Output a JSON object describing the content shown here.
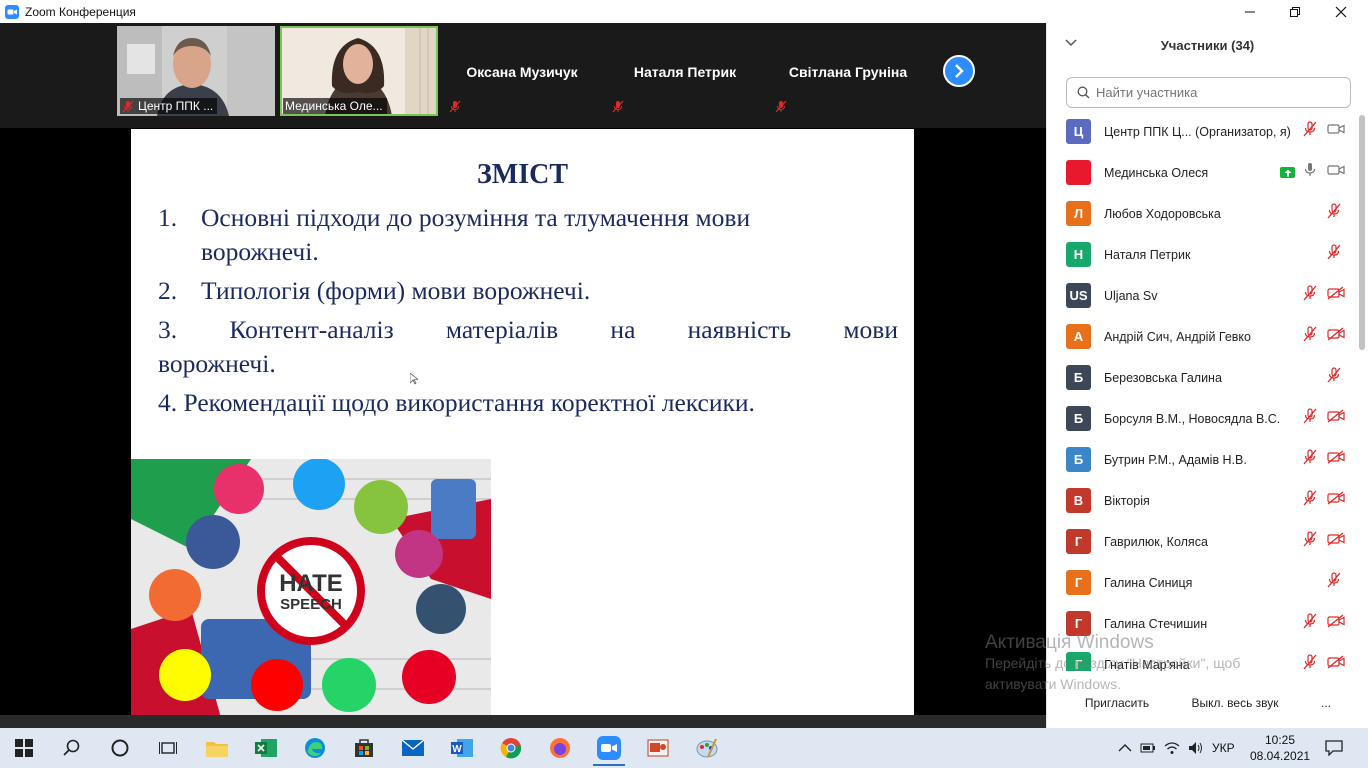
{
  "window": {
    "title": "Zoom Конференция"
  },
  "gallery": {
    "tiles": [
      {
        "name": "Центр ППК ...",
        "type": "video"
      },
      {
        "name": "Мединська Оле...",
        "type": "video"
      },
      {
        "name": "Оксана Музичук",
        "type": "name"
      },
      {
        "name": "Наталя Петрик",
        "type": "name"
      },
      {
        "name": "Світлана Груніна",
        "type": "name"
      }
    ]
  },
  "slide": {
    "title": "ЗМІСТ",
    "items": [
      {
        "num": "1.",
        "line1": "Основні підходи до розуміння та тлумачення мови",
        "line2": "ворожнечі."
      },
      {
        "num": "2.",
        "line1": "Типологія (форми) мови ворожнечі."
      },
      {
        "num": "3.",
        "line1": "Контент-аналіз матеріалів на наявність мови",
        "line2": "ворожнечі."
      },
      {
        "num": "4.",
        "line1": "Рекомендації щодо використання коректної лексики."
      }
    ],
    "image_text": {
      "line1": "HATE",
      "line2": "SPEECH"
    }
  },
  "participants": {
    "header": "Участники (34)",
    "search_placeholder": "Найти участника",
    "list": [
      {
        "initial": "Ц",
        "name": "Центр ППК Ц... (Организатор, я)",
        "color": "#5b6bc0",
        "mic": "muted",
        "video": "on"
      },
      {
        "initial": "",
        "name": "Мединська Олеся",
        "color": "#e8192c",
        "mic": "on",
        "video": "on",
        "sharing": true
      },
      {
        "initial": "Л",
        "name": "Любов Ходоровська",
        "color": "#e8701a",
        "mic": "muted",
        "video": "none"
      },
      {
        "initial": "Н",
        "name": "Наталя Петрик",
        "color": "#19a86b",
        "mic": "muted",
        "video": "none"
      },
      {
        "initial": "US",
        "name": "Uljana Sv",
        "color": "#3c4858",
        "mic": "muted",
        "video": "off"
      },
      {
        "initial": "А",
        "name": "Андрій Сич, Андрій Гевко",
        "color": "#e8701a",
        "mic": "muted",
        "video": "off"
      },
      {
        "initial": "Б",
        "name": "Березовська Галина",
        "color": "#3c4858",
        "mic": "muted",
        "video": "none"
      },
      {
        "initial": "Б",
        "name": "Борсуля В.М., Новосядла В.С.",
        "color": "#3c4858",
        "mic": "muted",
        "video": "off"
      },
      {
        "initial": "Б",
        "name": "Бутрин Р.М., Адамів Н.В.",
        "color": "#3a86c8",
        "mic": "muted",
        "video": "off"
      },
      {
        "initial": "В",
        "name": "Вікторія",
        "color": "#c0392b",
        "mic": "muted",
        "video": "off"
      },
      {
        "initial": "Г",
        "name": "Гаврилюк, Коляса",
        "color": "#c0392b",
        "mic": "muted",
        "video": "off"
      },
      {
        "initial": "Г",
        "name": "Галина Синиця",
        "color": "#e8701a",
        "mic": "muted",
        "video": "none"
      },
      {
        "initial": "Г",
        "name": "Галина Стечишин",
        "color": "#c0392b",
        "mic": "muted",
        "video": "off"
      },
      {
        "initial": "Г",
        "name": "Гнатів Мар'яна",
        "color": "#19a86b",
        "mic": "muted",
        "video": "off"
      }
    ],
    "invite_button": "Пригласить",
    "mute_all_button": "Выкл. весь звук",
    "more_button": "..."
  },
  "watermark": {
    "line1": "Активація Windows",
    "line2": "Перейдіть до розділу \"Настройки\", щоб",
    "line3": "активувати Windows."
  },
  "taskbar": {
    "language": "УКР",
    "time": "10:25",
    "date": "08.04.2021"
  },
  "colors": {
    "zoom_blue": "#2d8cff",
    "slide_text": "#1b2a5e",
    "mute_red": "#e02828"
  }
}
